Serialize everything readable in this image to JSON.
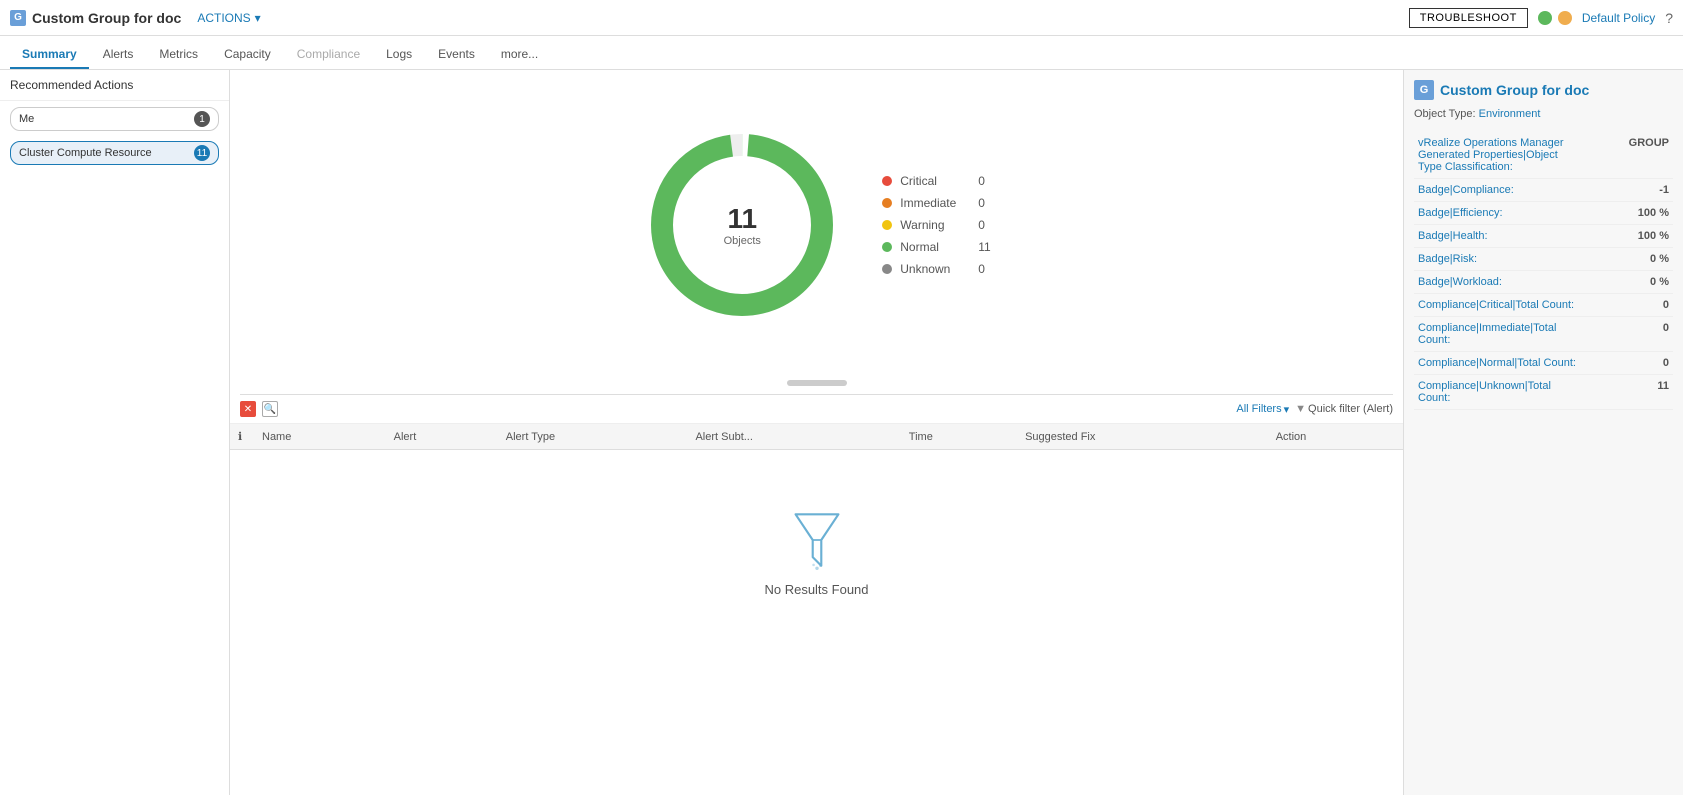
{
  "topbar": {
    "icon_label": "G",
    "title": "Custom Group for doc",
    "actions_label": "ACTIONS",
    "troubleshoot_label": "TROUBLESHOOT",
    "policy_label": "Default Policy"
  },
  "tabs": [
    {
      "id": "summary",
      "label": "Summary",
      "active": true,
      "disabled": false
    },
    {
      "id": "alerts",
      "label": "Alerts",
      "active": false,
      "disabled": false
    },
    {
      "id": "metrics",
      "label": "Metrics",
      "active": false,
      "disabled": false
    },
    {
      "id": "capacity",
      "label": "Capacity",
      "active": false,
      "disabled": false
    },
    {
      "id": "compliance",
      "label": "Compliance",
      "active": false,
      "disabled": true
    },
    {
      "id": "logs",
      "label": "Logs",
      "active": false,
      "disabled": false
    },
    {
      "id": "events",
      "label": "Events",
      "active": false,
      "disabled": false
    },
    {
      "id": "more",
      "label": "more...",
      "active": false,
      "disabled": false
    }
  ],
  "sidebar": {
    "header": "Recommended Actions",
    "filters": [
      {
        "id": "me",
        "label": "Me",
        "count": 1,
        "selected": false
      },
      {
        "id": "cluster",
        "label": "Cluster Compute Resource",
        "count": 11,
        "selected": true
      }
    ]
  },
  "chart": {
    "total": 11,
    "objects_label": "Objects",
    "legend": [
      {
        "label": "Critical",
        "count": 0,
        "color": "#e74c3c"
      },
      {
        "label": "Immediate",
        "count": 0,
        "color": "#e67e22"
      },
      {
        "label": "Warning",
        "count": 0,
        "color": "#f1c40f"
      },
      {
        "label": "Normal",
        "count": 11,
        "color": "#5cb85c"
      },
      {
        "label": "Unknown",
        "count": 0,
        "color": "#888888"
      }
    ]
  },
  "alerts": {
    "all_filters_label": "All Filters",
    "quick_filter_label": "Quick filter (Alert)",
    "columns": [
      {
        "id": "info",
        "label": ""
      },
      {
        "id": "name",
        "label": "Name"
      },
      {
        "id": "alert",
        "label": "Alert"
      },
      {
        "id": "alert_type",
        "label": "Alert Type"
      },
      {
        "id": "alert_subtype",
        "label": "Alert Subt..."
      },
      {
        "id": "time",
        "label": "Time"
      },
      {
        "id": "suggested_fix",
        "label": "Suggested Fix"
      },
      {
        "id": "action",
        "label": "Action"
      }
    ],
    "no_results_label": "No Results Found"
  },
  "right_panel": {
    "title": "Custom Group for doc",
    "object_type_label": "Object Type:",
    "object_type_value": "Environment",
    "properties": [
      {
        "label": "vRealize Operations Manager Generated Properties|Object Type Classification:",
        "value": "GROUP"
      },
      {
        "label": "Badge|Compliance:",
        "value": "-1"
      },
      {
        "label": "Badge|Efficiency:",
        "value": "100 %"
      },
      {
        "label": "Badge|Health:",
        "value": "100 %"
      },
      {
        "label": "Badge|Risk:",
        "value": "0 %"
      },
      {
        "label": "Badge|Workload:",
        "value": "0 %"
      },
      {
        "label": "Compliance|Critical|Total Count:",
        "value": "0"
      },
      {
        "label": "Compliance|Immediate|Total Count:",
        "value": "0"
      },
      {
        "label": "Compliance|Normal|Total Count:",
        "value": "0"
      },
      {
        "label": "Compliance|Unknown|Total Count:",
        "value": "11"
      }
    ]
  }
}
